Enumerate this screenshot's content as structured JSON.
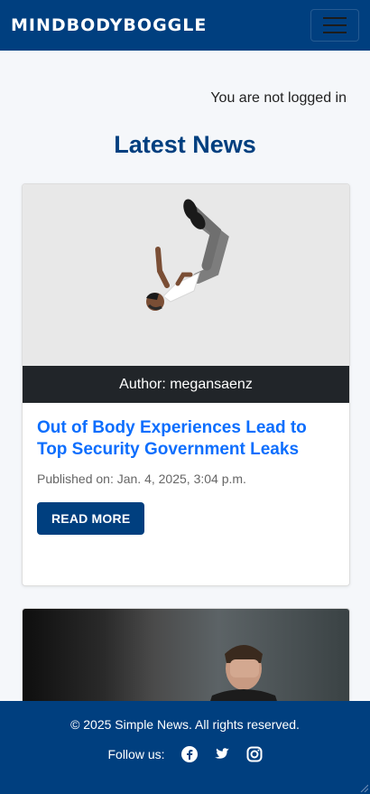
{
  "brand": "MINDBODYBOGGLE",
  "nav_toggle_icon": "hamburger-menu-icon",
  "login_status": "You are not logged in",
  "section_title": "Latest News",
  "articles": [
    {
      "author": "Author: megansaenz",
      "title": "Out of Body Experiences Lead to Top Security Government Leaks",
      "published": "Published on: Jan. 4, 2025, 3:04 p.m.",
      "button": "READ MORE"
    },
    {
      "author": "",
      "title": "",
      "published": "",
      "button": ""
    }
  ],
  "footer": {
    "copyright": "© 2025 Simple News. All rights reserved.",
    "follow_label": "Follow us:",
    "social_icons": [
      "facebook-icon",
      "twitter-icon",
      "instagram-icon"
    ]
  },
  "colors": {
    "primary": "#003f7f",
    "link": "#0d6efd",
    "author_bar": "#212529"
  }
}
